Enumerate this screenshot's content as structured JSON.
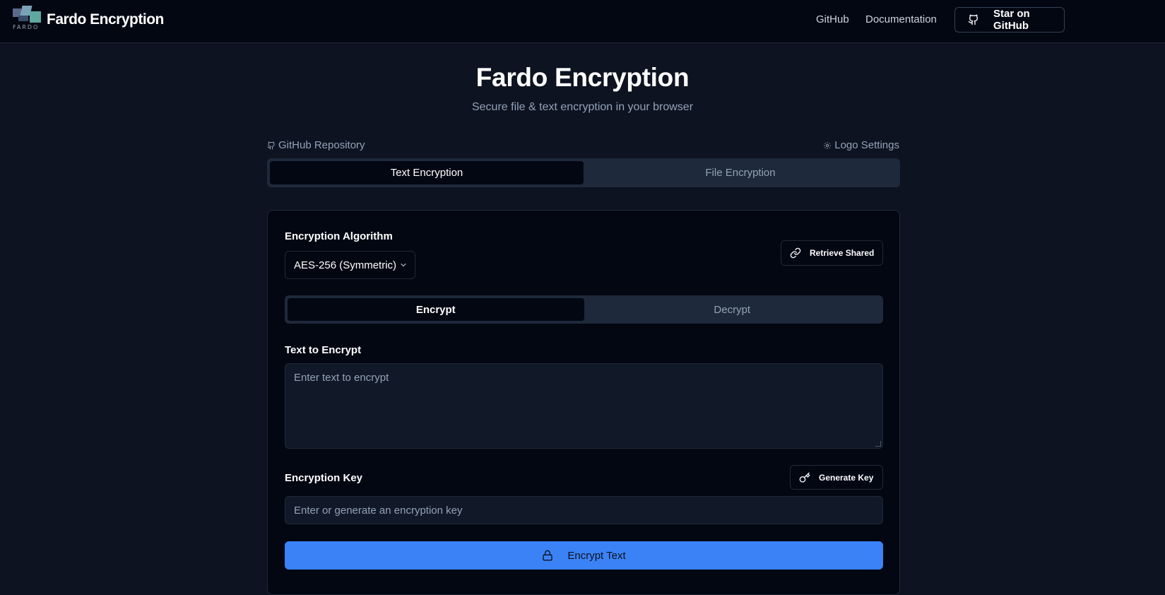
{
  "nav": {
    "brand_title": "Fardo Encryption",
    "logo_wordmark": "FARDO",
    "links": {
      "github": "GitHub",
      "documentation": "Documentation"
    },
    "star_button": "Star on GitHub"
  },
  "hero": {
    "title": "Fardo Encryption",
    "subtitle": "Secure file & text encryption in your browser"
  },
  "links": {
    "repo": "GitHub Repository",
    "logo_settings": "Logo Settings"
  },
  "main_tabs": [
    {
      "label": "Text Encryption",
      "active": true
    },
    {
      "label": "File Encryption",
      "active": false
    }
  ],
  "card": {
    "algorithm_label": "Encryption Algorithm",
    "algorithm_selected": "AES-256 (Symmetric)",
    "retrieve_button": "Retrieve Shared",
    "mode_tabs": [
      {
        "label": "Encrypt",
        "active": true
      },
      {
        "label": "Decrypt",
        "active": false
      }
    ],
    "text_label": "Text to Encrypt",
    "text_placeholder": "Enter text to encrypt",
    "key_label": "Encryption Key",
    "generate_button": "Generate Key",
    "key_placeholder": "Enter or generate an encryption key",
    "encrypt_button": "Encrypt Text"
  },
  "colors": {
    "background": "#0d1320",
    "topbar": "#030712",
    "accent": "#3b82f6",
    "muted_text": "#94a3b8"
  },
  "icons": {
    "star_button": "github-icon",
    "repo": "github-icon",
    "logo_settings": "gear-icon",
    "retrieve": "link-icon",
    "generate": "key-icon",
    "encrypt": "lock-icon",
    "select": "chevron-down-icon"
  }
}
